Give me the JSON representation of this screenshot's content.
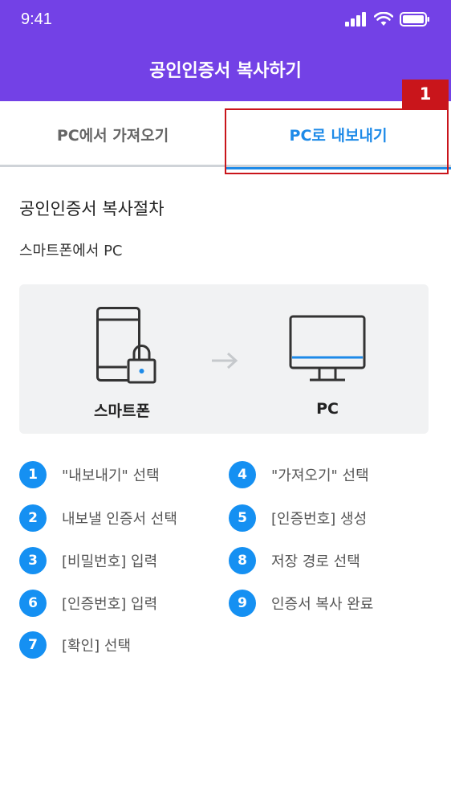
{
  "status_bar": {
    "time": "9:41"
  },
  "header": {
    "title": "공인인증서 복사하기"
  },
  "tabs": [
    {
      "label": "PC에서 가져오기",
      "active": false
    },
    {
      "label": "PC로 내보내기",
      "active": true
    }
  ],
  "annotation": {
    "badge": "1",
    "color": "#c9151b"
  },
  "section": {
    "title": "공인인증서 복사절차",
    "subtitle": "스마트폰에서 PC"
  },
  "illustration": {
    "from_label": "스마트폰",
    "to_label": "PC",
    "from_icon": "smartphone-lock-icon",
    "arrow_icon": "arrow-right-icon",
    "to_icon": "monitor-icon"
  },
  "steps_left": [
    {
      "num": "1",
      "text": "\"내보내기\" 선택"
    },
    {
      "num": "2",
      "text": "내보낼 인증서 선택"
    },
    {
      "num": "3",
      "text": "[비밀번호] 입력"
    },
    {
      "num": "6",
      "text": "[인증번호] 입력"
    },
    {
      "num": "7",
      "text": "[확인] 선택"
    }
  ],
  "steps_right": [
    {
      "num": "4",
      "text": "\"가져오기\" 선택"
    },
    {
      "num": "5",
      "text": "[인증번호] 생성"
    },
    {
      "num": "8",
      "text": "저장 경로 선택"
    },
    {
      "num": "9",
      "text": "인증서 복사 완료"
    }
  ],
  "colors": {
    "header": "#7341e6",
    "accent": "#1d8ae8",
    "step_badge": "#1590f2",
    "annotation": "#c9151b"
  }
}
